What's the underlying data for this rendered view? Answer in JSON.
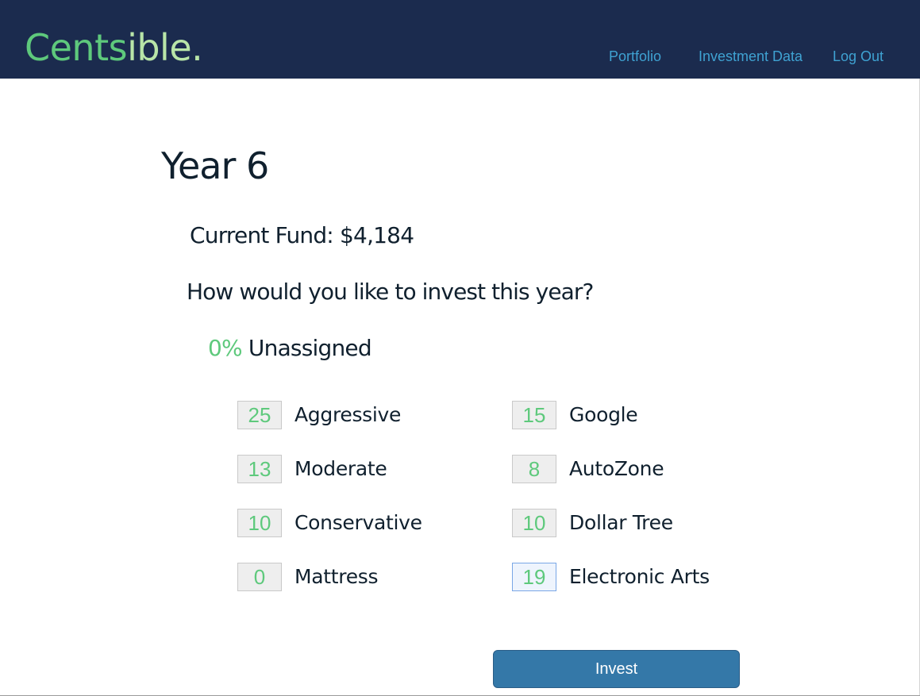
{
  "header": {
    "brand_part1": "Cents",
    "brand_part2": "ible.",
    "nav": {
      "portfolio": "Portfolio",
      "investment_data": "Investment Data",
      "logout": "Log Out"
    }
  },
  "main": {
    "year_title": "Year 6",
    "current_fund": "Current Fund: $4,184",
    "question": "How would you like to invest this year?",
    "unassigned_pct": "0%",
    "unassigned_label": " Unassigned",
    "allocations_left": [
      {
        "value": "25",
        "label": "Aggressive"
      },
      {
        "value": "13",
        "label": "Moderate"
      },
      {
        "value": "10",
        "label": "Conservative"
      },
      {
        "value": "0",
        "label": "Mattress"
      }
    ],
    "allocations_right": [
      {
        "value": "15",
        "label": "Google"
      },
      {
        "value": "8",
        "label": "AutoZone"
      },
      {
        "value": "10",
        "label": "Dollar Tree"
      },
      {
        "value": "19",
        "label": "Electronic Arts"
      }
    ],
    "invest_button": "Invest"
  },
  "colors": {
    "navbar": "#1b2b4e",
    "brand_green": "#5ec97c",
    "brand_light_green": "#b8e5a8",
    "nav_link": "#3fa2d2",
    "button": "#3478a8"
  }
}
